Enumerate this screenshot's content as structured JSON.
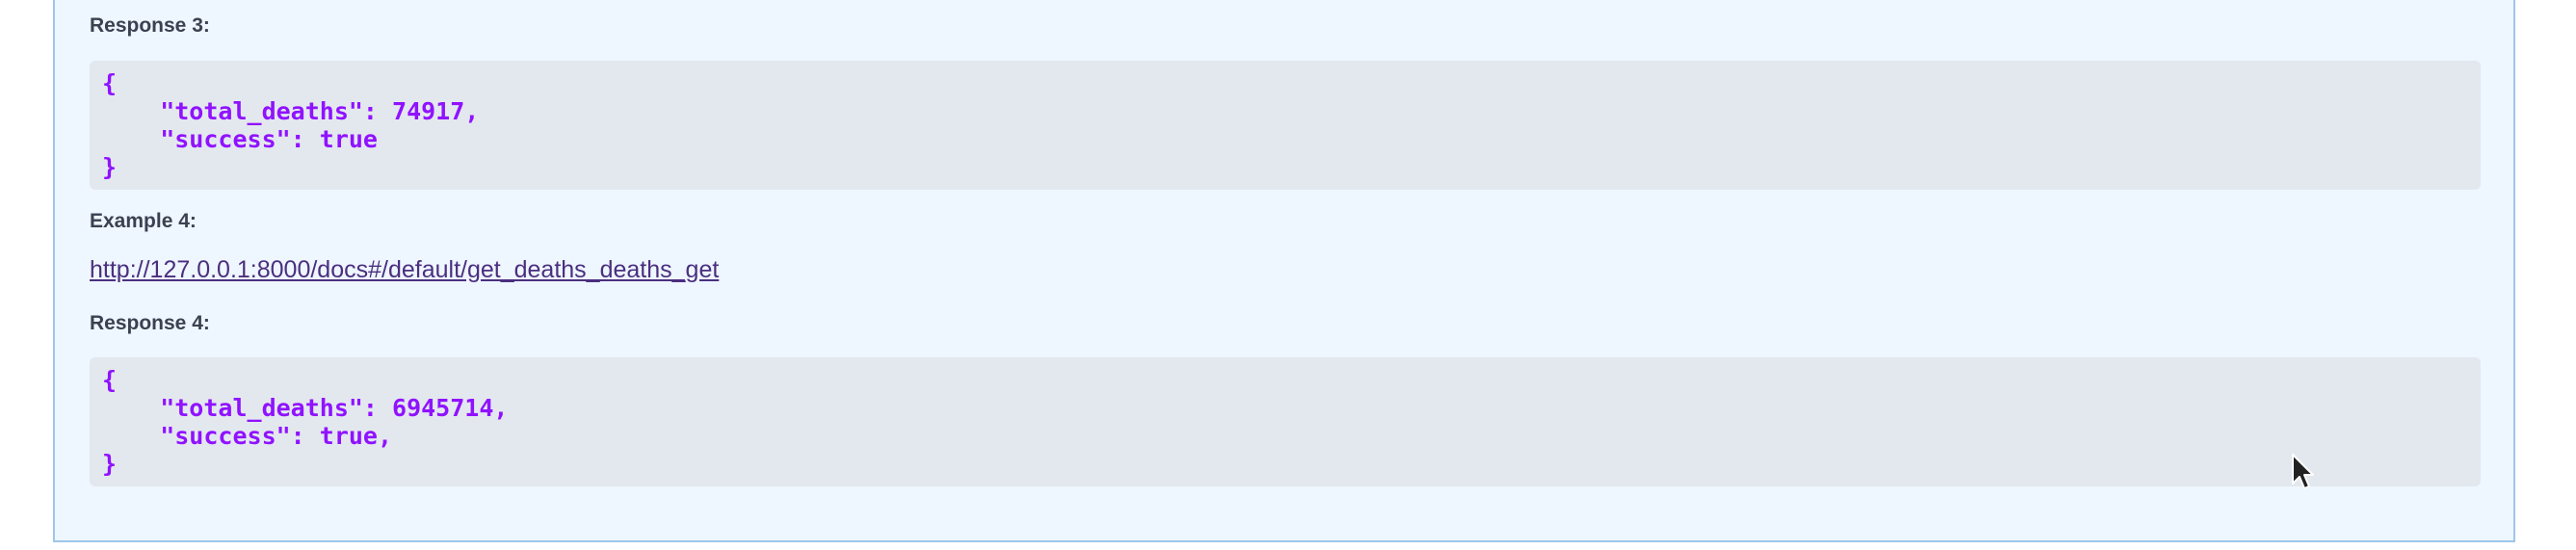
{
  "response3": {
    "label": "Response 3:",
    "lines": [
      "{",
      "    \"total_deaths\": 74917,",
      "    \"success\": true",
      "}"
    ]
  },
  "example4": {
    "label": "Example 4:",
    "link": "http://127.0.0.1:8000/docs#/default/get_deaths_deaths_get"
  },
  "response4": {
    "label": "Response 4:",
    "lines": [
      "{",
      "    \"total_deaths\": 6945714,",
      "    \"success\": true,",
      "}"
    ]
  },
  "colors": {
    "panel_bg": "#eef6ff",
    "panel_border": "#9cc6ea",
    "code_bg": "#e3e8ef",
    "code_text": "#9012fe",
    "label_text": "#3b4151",
    "link": "#4b2f7f"
  },
  "icons": {
    "cursor": "mouse-pointer-icon"
  }
}
